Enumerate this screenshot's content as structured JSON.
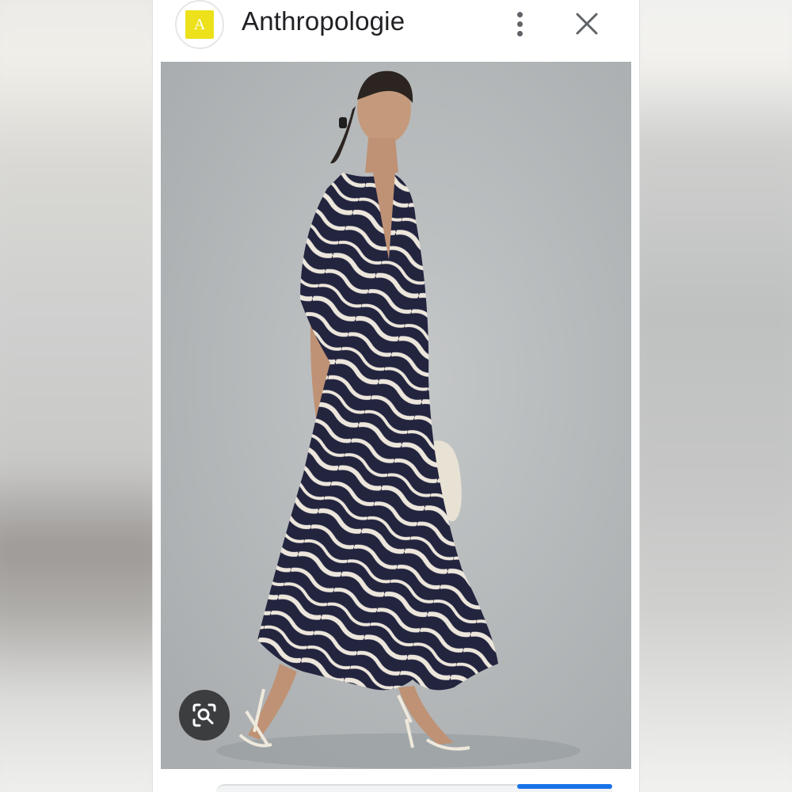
{
  "header": {
    "site_icon_letter": "A",
    "site_icon_color": "#ece11b",
    "site_name": "Anthropologie",
    "more_icon": "more-vertical-icon",
    "close_icon": "close-icon"
  },
  "image": {
    "background_color": "#b7bbbd",
    "dress_colors": [
      "#23253f",
      "#ece6dc"
    ]
  },
  "lens_button": {
    "icon": "lens-search-icon"
  }
}
